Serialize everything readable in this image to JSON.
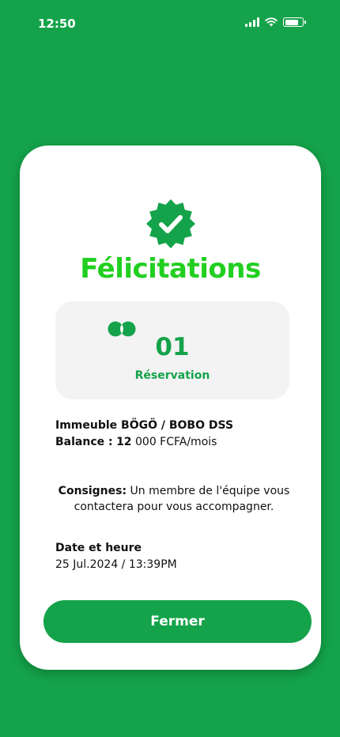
{
  "status_bar": {
    "time": "12:50",
    "battery_level": 0.8
  },
  "dialog": {
    "badge_icon": "verified-check-badge-icon",
    "title": "Félicitations",
    "counter": {
      "icon": "rings-icon",
      "value": "01",
      "label": "Réservation"
    },
    "property": {
      "name": "Immeuble BÖGÖ / BOBO DSS",
      "balance_label": "Balance :",
      "balance_amount_bold": "12",
      "balance_amount_rest": "000 FCFA/mois"
    },
    "instructions": {
      "label": "Consignes:",
      "text": "Un membre de l'équipe vous contactera pour vous accompagner."
    },
    "datetime": {
      "label": "Date et heure",
      "value": "25 Jul.2024 / 13:39PM"
    },
    "close_button": "Fermer"
  },
  "colors": {
    "background": "#14a34a",
    "title": "#21cf21",
    "card": "#ffffff"
  }
}
